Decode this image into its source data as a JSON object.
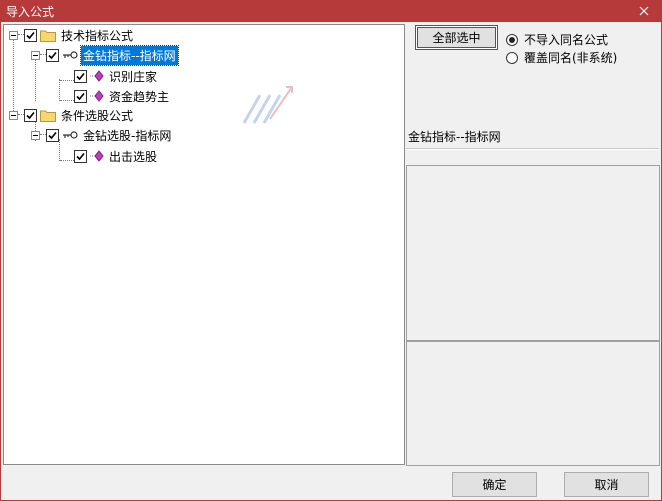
{
  "window": {
    "title": "导入公式"
  },
  "tree": {
    "groups": [
      {
        "label": "技术指标公式",
        "checked": true,
        "formula": {
          "label": "金钻指标--指标网",
          "checked": true,
          "selected": true,
          "items": [
            {
              "label": "识别庄家",
              "checked": true
            },
            {
              "label": "资金趋势主",
              "checked": true
            }
          ]
        }
      },
      {
        "label": "条件选股公式",
        "checked": true,
        "formula": {
          "label": "金钻选股-指标网",
          "checked": true,
          "selected": false,
          "items": [
            {
              "label": "出击选股",
              "checked": true
            }
          ]
        }
      }
    ]
  },
  "buttons": {
    "select_all": "全部选中",
    "ok": "确定",
    "cancel": "取消"
  },
  "options": [
    {
      "label": "不导入同名公式",
      "selected": true
    },
    {
      "label": "覆盖同名(非系统)",
      "selected": false
    }
  ],
  "info": {
    "formula_name": "金钻指标--指标网"
  },
  "colors": {
    "titlebar": "#b63a3a",
    "selection": "#0078d7",
    "folder": "#f5d76e",
    "item_icon": "#c23bc2"
  },
  "icons": {
    "folder": "folder-icon",
    "key": "key-icon",
    "diamond": "diamond-icon",
    "close": "close-icon",
    "check": "check-icon"
  }
}
